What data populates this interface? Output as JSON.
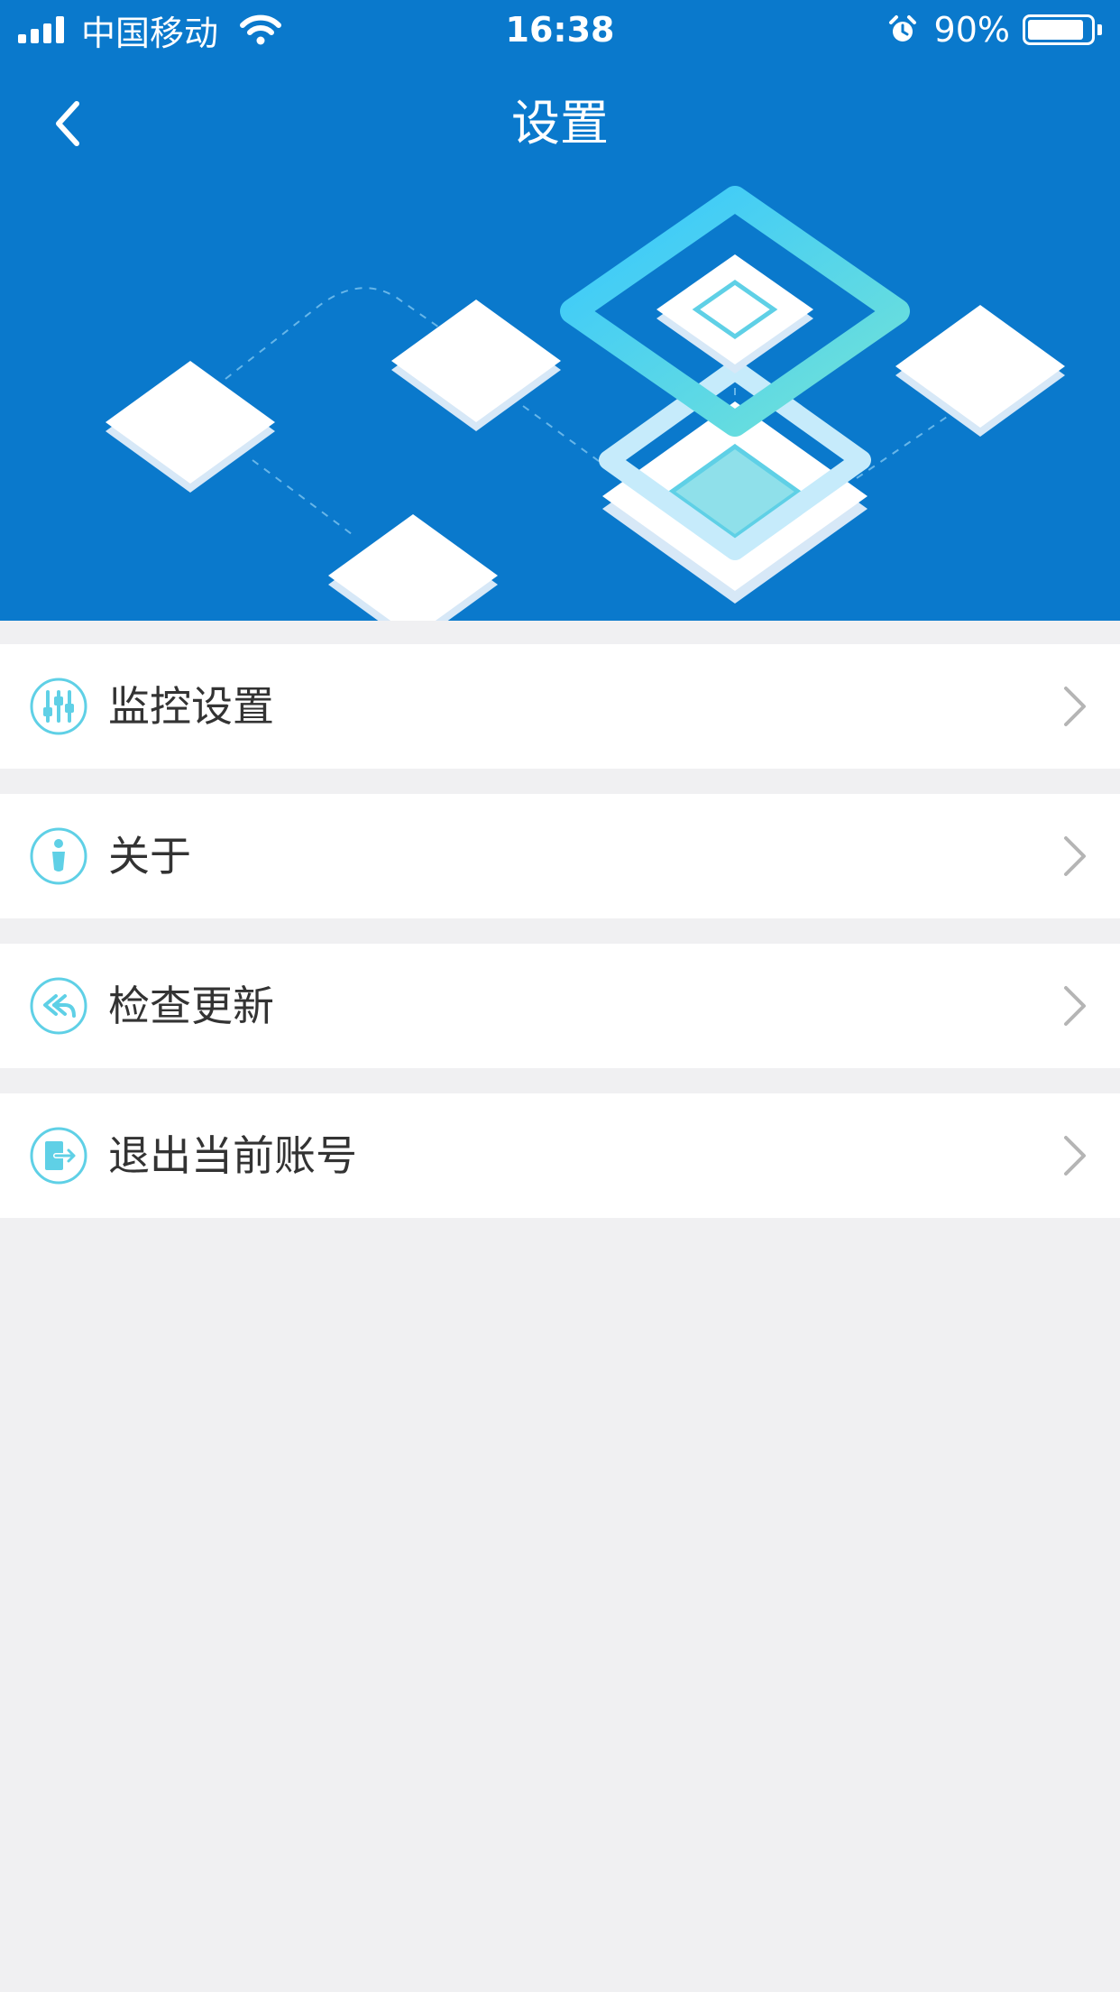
{
  "status_bar": {
    "carrier": "中国移动",
    "time": "16:38",
    "battery": "90%",
    "battery_level": 0.9,
    "icons": [
      "signal-icon",
      "wifi-icon",
      "alarm-icon",
      "battery-icon"
    ]
  },
  "navbar": {
    "title": "设置",
    "back_icon": "chevron-left-icon"
  },
  "colors": {
    "header_blue": "#0a79cc",
    "icon_cyan": "#5fd0e6",
    "background": "#f0f0f2",
    "chevron": "#b5b5b5"
  },
  "menu": {
    "items": [
      {
        "label": "监控设置",
        "icon": "sliders-icon"
      },
      {
        "label": "关于",
        "icon": "info-person-icon"
      },
      {
        "label": "检查更新",
        "icon": "reply-all-icon"
      },
      {
        "label": "退出当前账号",
        "icon": "logout-door-icon"
      }
    ]
  }
}
